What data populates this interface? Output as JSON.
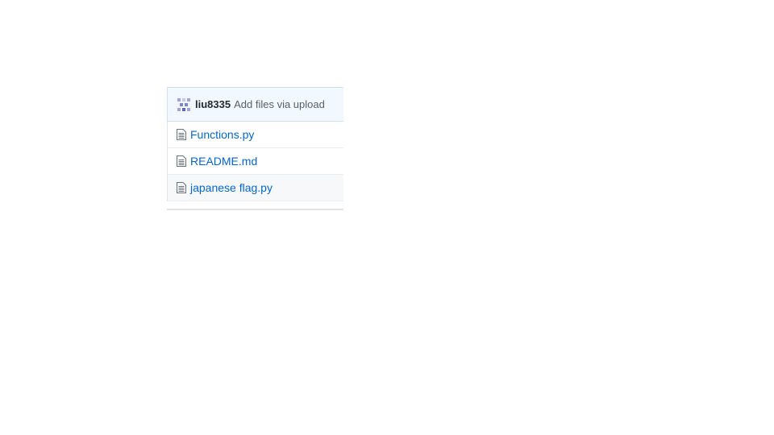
{
  "commit": {
    "author": "liu8335",
    "message": "Add files via upload"
  },
  "files": [
    {
      "name": "Functions.py",
      "icon": "file-icon"
    },
    {
      "name": "README.md",
      "icon": "file-icon"
    },
    {
      "name": "japanese flag.py",
      "icon": "file-icon"
    }
  ],
  "colors": {
    "commit_bar_bg": "#f1f8ff",
    "link": "#0366d6",
    "muted_text": "#586069"
  }
}
